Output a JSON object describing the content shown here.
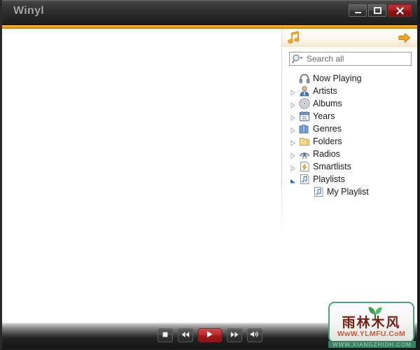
{
  "window": {
    "title": "Winyl",
    "controls": [
      {
        "name": "minimize",
        "glyph": "minimize-icon"
      },
      {
        "name": "maximize",
        "glyph": "maximize-icon"
      },
      {
        "name": "close",
        "glyph": "close-icon"
      }
    ]
  },
  "sidebar": {
    "header": {
      "logo_icon": "music-note-icon",
      "nav_icon": "arrow-right-icon"
    },
    "search": {
      "placeholder": "Search all",
      "value": "",
      "icon": "search-magnifier-icon"
    },
    "tree": [
      {
        "label": "Now Playing",
        "icon": "headphones-icon",
        "twisty": "none",
        "level": 0
      },
      {
        "label": "Artists",
        "icon": "person-icon",
        "twisty": "collapsed",
        "level": 0
      },
      {
        "label": "Albums",
        "icon": "disc-icon",
        "twisty": "collapsed",
        "level": 0
      },
      {
        "label": "Years",
        "icon": "calendar-icon",
        "twisty": "collapsed",
        "level": 0
      },
      {
        "label": "Genres",
        "icon": "books-icon",
        "twisty": "collapsed",
        "level": 0
      },
      {
        "label": "Folders",
        "icon": "folder-icon",
        "twisty": "collapsed",
        "level": 0
      },
      {
        "label": "Radios",
        "icon": "radio-tower-icon",
        "twisty": "collapsed",
        "level": 0
      },
      {
        "label": "Smartlists",
        "icon": "lightning-icon",
        "twisty": "collapsed",
        "level": 0
      },
      {
        "label": "Playlists",
        "icon": "playlist-icon",
        "twisty": "expanded",
        "level": 0
      },
      {
        "label": "My Playlist",
        "icon": "playlist-icon",
        "twisty": "none",
        "level": 1
      }
    ]
  },
  "transport": {
    "buttons": [
      {
        "name": "stop",
        "icon": "stop-icon",
        "accent": false
      },
      {
        "name": "previous",
        "icon": "rewind-icon",
        "accent": false
      },
      {
        "name": "play",
        "icon": "play-icon",
        "accent": true
      },
      {
        "name": "next",
        "icon": "fast-forward-icon",
        "accent": false
      },
      {
        "name": "volume",
        "icon": "speaker-icon",
        "accent": false
      }
    ]
  },
  "watermark": {
    "characters": "雨林木风",
    "url": "WwW.YLMFU.CoM",
    "sub": "WWW.XIANGZHIDH.COM"
  },
  "colors": {
    "accent_orange": "#f0a41c",
    "close_red": "#a82020",
    "play_red": "#bd2b2b",
    "titlebar_dark": "#2b2b2b"
  }
}
